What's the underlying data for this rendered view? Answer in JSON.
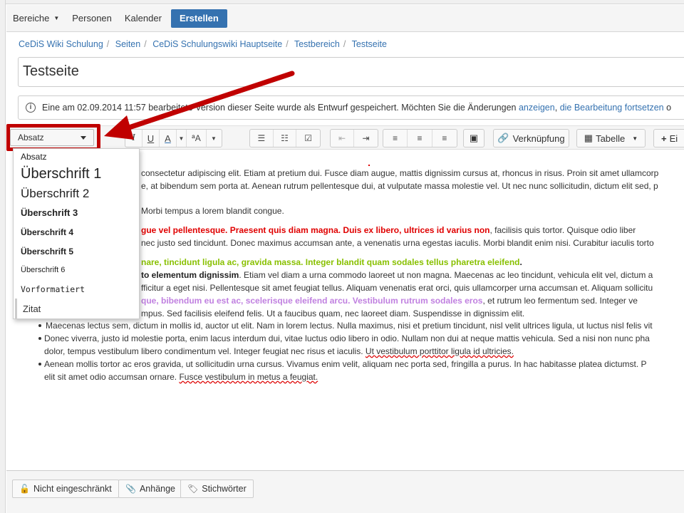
{
  "nav": {
    "items": [
      "Bereiche",
      "Personen",
      "Kalender"
    ],
    "create": "Erstellen"
  },
  "breadcrumb": [
    "CeDiS Wiki Schulung",
    "Seiten",
    "CeDiS Schulungswiki Hauptseite",
    "Testbereich",
    "Testseite"
  ],
  "page_title": "Testseite",
  "notice": {
    "text": "Eine am 02.09.2014 11:57 bearbeitete Version dieser Seite wurde als Entwurf gespeichert. Möchten Sie die Änderungen",
    "link1": "anzeigen",
    "sep": ",",
    "link2": "die Bearbeitung fortsetzen",
    "tail": "o"
  },
  "toolbar": {
    "paragraph_label": "Absatz",
    "italic": "I",
    "underline": "U",
    "color": "A",
    "link": "Verknüpfung",
    "table": "Tabelle",
    "insert": "Ei"
  },
  "dropdown": {
    "items": [
      "Absatz",
      "Überschrift 1",
      "Überschrift 2",
      "Überschrift 3",
      "Überschrift 4",
      "Überschrift 5",
      "Überschrift 6",
      "Vorformatiert",
      "Zitat"
    ]
  },
  "content": {
    "p1": [
      "consectetur adipiscing elit. Etiam at pretium dui. Fusce diam augue, mattis dignissim cursus at, rhoncus in risus. Proin sit amet ullamcorp",
      "e, at bibendum sem porta at. Aenean rutrum pellentesque dui, at vulputate massa molestie vel. Ut nec nunc sollicitudin, dictum elit sed, p",
      "Morbi tempus a lorem blandit congue."
    ],
    "p2_red": "gue vel pellentesque. Praesent quis diam magna. Duis ex libero, ultrices id varius non",
    "p2_rest": ", facilisis quis tortor. Quisque odio liber",
    "p2_line2": "nec justo sed tincidunt. Donec maximus accumsan ante, a venenatis urna egestas iaculis. Morbi blandit enim nisi. Curabitur iaculis torto",
    "p3_green": "nare, tincidunt ligula ac, gravida massa. Integer blandit quam sodales tellus pharetra eleifend",
    "p3_dot": ".",
    "p4_bold": "to elementum dignissim",
    "p4_rest": ". Etiam vel diam a urna commodo laoreet ut non magna. Maecenas ac leo tincidunt, vehicula elit vel, dictum a",
    "p4_line2": "fficitur a eget nisi. Pellentesque sit amet feugiat tellus. Aliquam venenatis erat orci, quis ullamcorper urna accumsan et. Aliquam sollicitu",
    "p4_purple": "que, bibendum eu est ac, scelerisque eleifend arcu. Vestibulum rutrum sodales eros",
    "p4_purple_rest": ", et rutrum leo fermentum sed. Integer ve",
    "p4_line4": "mpus. Sed facilisis eleifend felis. Ut a faucibus quam, nec laoreet diam. Suspendisse in dignissim elit.",
    "bullets": [
      [
        "Maecenas lectus sem, dictum in mollis id, auctor ut elit. Nam in lorem lectus. Nulla maximus, nisi et pretium tincidunt, nisl velit ultrices ligula, ut luctus nisl felis vit"
      ],
      [
        "Donec viverra, justo id molestie porta, enim lacus interdum dui, vitae luctus odio libero in odio. Nullam non dui at neque mattis vehicula. Sed a nisi non nunc pha",
        "dolor, tempus vestibulum libero condimentum vel. Integer feugiat nec risus et iaculis.",
        "Ut vestibulum porttitor ligula id ultricies."
      ],
      [
        "Aenean mollis tortor ac eros gravida, ut sollicitudin urna cursus. Vivamus enim velit, aliquam nec porta sed, fringilla a purus. In hac habitasse platea dictumst. P",
        "elit sit amet odio accumsan ornare.",
        "Fusce vestibulum in metus a feugiat."
      ]
    ]
  },
  "footer": {
    "restriction": "Nicht eingeschränkt",
    "attachments": "Anhänge",
    "labels": "Stichwörter"
  },
  "colors": {
    "accent": "#3572b0",
    "highlight": "#c00000",
    "red_text": "#e00000",
    "green_text": "#88c000",
    "purple_text": "#c080e0"
  }
}
